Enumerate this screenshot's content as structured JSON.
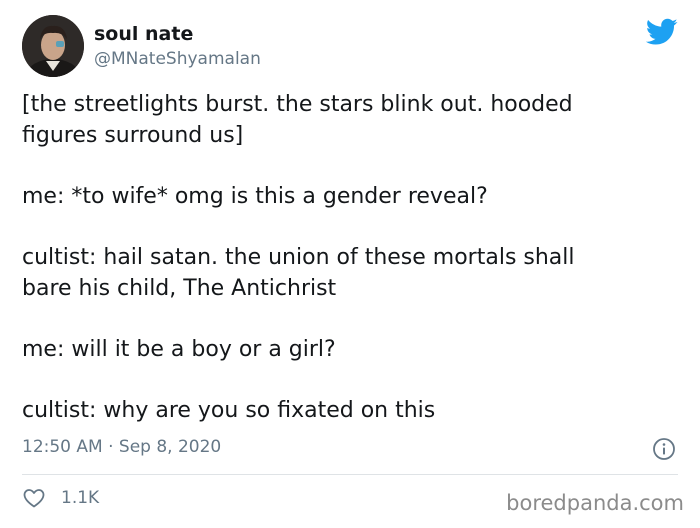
{
  "author": {
    "name": "soul nate",
    "handle": "@MNateShyamalan"
  },
  "tweet": {
    "paragraphs": [
      "[the streetlights burst. the stars blink out. hooded\nfigures surround us]",
      "me: *to wife* omg is this a gender reveal?",
      "cultist: hail satan. the union of these mortals shall\nbare his child, The Antichrist",
      "me: will it be a boy or a girl?",
      "cultist: why are you so fixated on this"
    ],
    "timestamp": "12:50 AM · Sep 8, 2020"
  },
  "engagement": {
    "likes": "1.1K"
  },
  "watermark": "boredpanda.com",
  "colors": {
    "twitter_blue": "#1da1f2",
    "secondary_text": "#657786",
    "primary_text": "#14171a"
  },
  "icons": {
    "brand": "twitter-bird-icon",
    "info": "info-icon",
    "like": "heart-icon"
  }
}
